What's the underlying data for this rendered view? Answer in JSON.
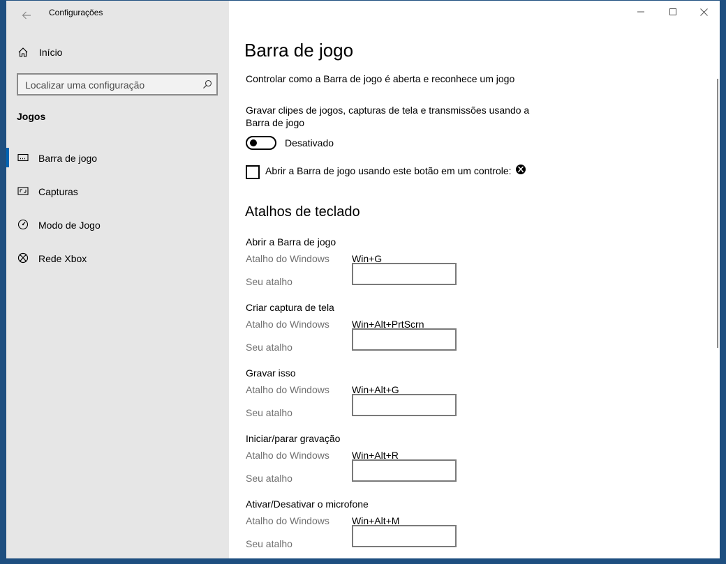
{
  "app_title": "Configurações",
  "sidebar": {
    "home_label": "Início",
    "search_placeholder": "Localizar uma configuração",
    "section_title": "Jogos",
    "items": [
      {
        "label": "Barra de jogo",
        "icon": "game-bar-icon",
        "active": true
      },
      {
        "label": "Capturas",
        "icon": "captures-icon",
        "active": false
      },
      {
        "label": "Modo de Jogo",
        "icon": "game-mode-icon",
        "active": false
      },
      {
        "label": "Rede Xbox",
        "icon": "xbox-icon",
        "active": false
      }
    ]
  },
  "main": {
    "title": "Barra de jogo",
    "description": "Controlar como a Barra de jogo é aberta e reconhece um jogo",
    "record_label": "Gravar clipes de jogos, capturas de tela e transmissões usando a Barra de jogo",
    "toggle_state": "Desativado",
    "checkbox_label": "Abrir a Barra de jogo usando este botão em um controle:",
    "shortcuts_title": "Atalhos de teclado",
    "windows_shortcut_label": "Atalho do Windows",
    "your_shortcut_label": "Seu atalho",
    "shortcuts": [
      {
        "title": "Abrir a Barra de jogo",
        "windows": "Win+G",
        "custom": ""
      },
      {
        "title": "Criar captura de tela",
        "windows": "Win+Alt+PrtScrn",
        "custom": ""
      },
      {
        "title": "Gravar isso",
        "windows": "Win+Alt+G",
        "custom": ""
      },
      {
        "title": "Iniciar/parar gravação",
        "windows": "Win+Alt+R",
        "custom": ""
      },
      {
        "title": "Ativar/Desativar o microfone",
        "windows": "Win+Alt+M",
        "custom": ""
      }
    ]
  },
  "colors": {
    "accent": "#0063b1",
    "sidebar_bg": "#e6e6e6",
    "desktop_bg": "#1e4f80"
  }
}
